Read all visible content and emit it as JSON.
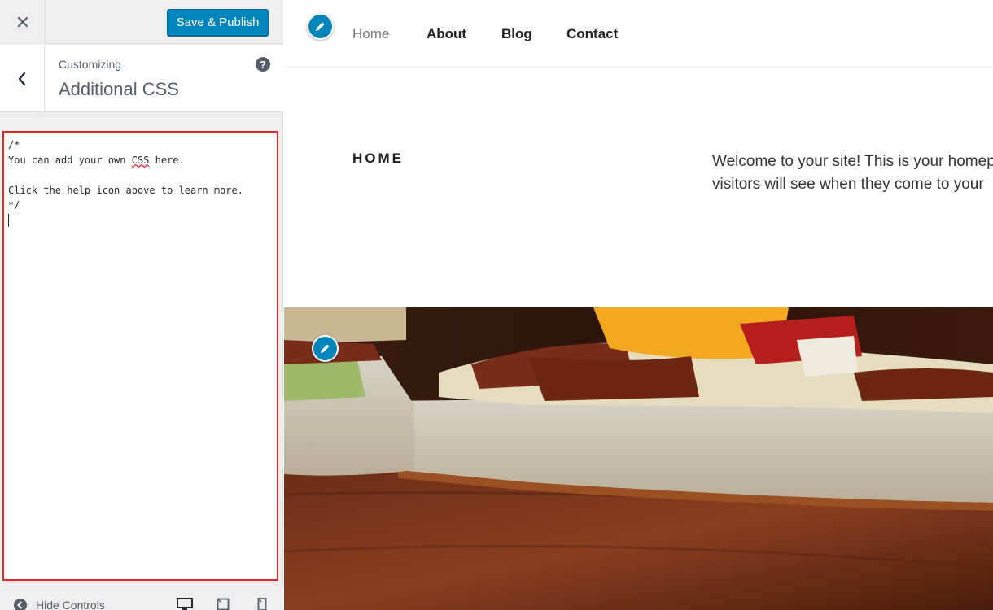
{
  "customizer": {
    "close_label": "Close",
    "save_publish": "Save & Publish",
    "customizing_label": "Customizing",
    "section_title": "Additional CSS",
    "help_icon": "?",
    "css_lines": {
      "l1": "/*",
      "l2a": "You can add your own ",
      "l2b": "CSS",
      "l2c": " here.",
      "l3": "",
      "l4": "Click the help icon above to learn more.",
      "l5": "*/"
    },
    "hide_controls": "Hide Controls"
  },
  "site": {
    "nav": [
      "Home",
      "About",
      "Blog",
      "Contact"
    ],
    "current_nav": "Home",
    "page_title": "HOME",
    "intro": {
      "line1": "Welcome to your site! This is your homep",
      "line2": "visitors will see when they come to your"
    }
  },
  "icons": {
    "close": "close-icon",
    "back": "chevron-left-icon",
    "help": "help-icon",
    "hide_controls": "arrow-left-circle-icon",
    "devices": [
      "desktop-icon",
      "tablet-icon",
      "mobile-icon"
    ],
    "edit": "pencil-icon"
  },
  "colors": {
    "primary": "#0085ba",
    "highlight": "#e0282b",
    "sidebar_bg": "#eeeeee"
  }
}
